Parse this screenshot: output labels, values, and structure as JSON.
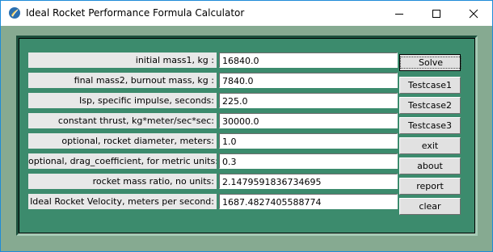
{
  "window": {
    "title": "Ideal Rocket Performance Formula Calculator",
    "accent_color": "#1f8bd8",
    "client_color": "#86aa91",
    "panel_color": "#3c8b6d"
  },
  "title_controls": {
    "minimize_icon": "minimize-icon",
    "maximize_icon": "maximize-icon",
    "close_icon": "close-icon"
  },
  "fields": [
    {
      "label": "initial mass1, kg :",
      "value": "16840.0"
    },
    {
      "label": "final mass2, burnout mass,  kg  :",
      "value": "7840.0"
    },
    {
      "label": "Isp, specific impulse, seconds:",
      "value": "225.0"
    },
    {
      "label": "constant thrust, kg*meter/sec*sec:",
      "value": "30000.0"
    },
    {
      "label": "optional, rocket diameter, meters:",
      "value": "1.0"
    },
    {
      "label": "optional, drag_coefficient, for metric units:",
      "value": "0.3"
    },
    {
      "label": "rocket mass ratio, no units:",
      "value": "2.1479591836734695"
    },
    {
      "label": "Ideal Rocket Velocity, meters per second:",
      "value": "1687.4827405588774"
    }
  ],
  "buttons": {
    "solve": "Solve",
    "testcase1": "Testcase1",
    "testcase2": "Testcase2",
    "testcase3": "Testcase3",
    "exit": "exit",
    "about": "about",
    "report": "report",
    "clear": "clear"
  }
}
